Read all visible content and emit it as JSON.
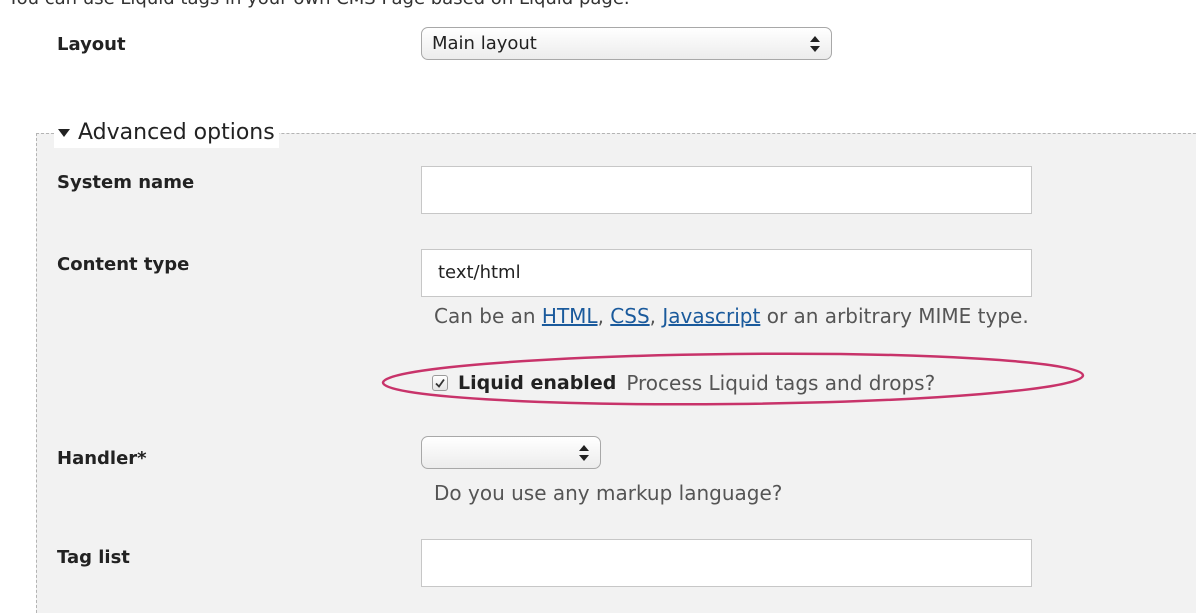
{
  "top_text": "You can use Liquid tags in your own CMS Page based on Liquid page.",
  "layout": {
    "label": "Layout",
    "selected": "Main layout"
  },
  "advanced": {
    "legend": "Advanced options",
    "system_name": {
      "label": "System name",
      "value": ""
    },
    "content_type": {
      "label": "Content type",
      "value": "text/html",
      "hint_prefix": "Can be an",
      "link_html": "HTML",
      "sep1": ",",
      "link_css": "CSS",
      "sep2": ",",
      "link_js": "Javascript",
      "hint_suffix": "or an arbitrary MIME type."
    },
    "liquid": {
      "label": "Liquid enabled",
      "description": "Process Liquid tags and drops?",
      "checked": true
    },
    "handler": {
      "label": "Handler*",
      "selected": "",
      "hint": "Do you use any markup language?"
    },
    "tag_list": {
      "label": "Tag list",
      "value": ""
    }
  },
  "colors": {
    "highlight_ellipse": "#c8336a",
    "link": "#1a5a9c",
    "fieldset_bg": "#f2f2f2"
  }
}
